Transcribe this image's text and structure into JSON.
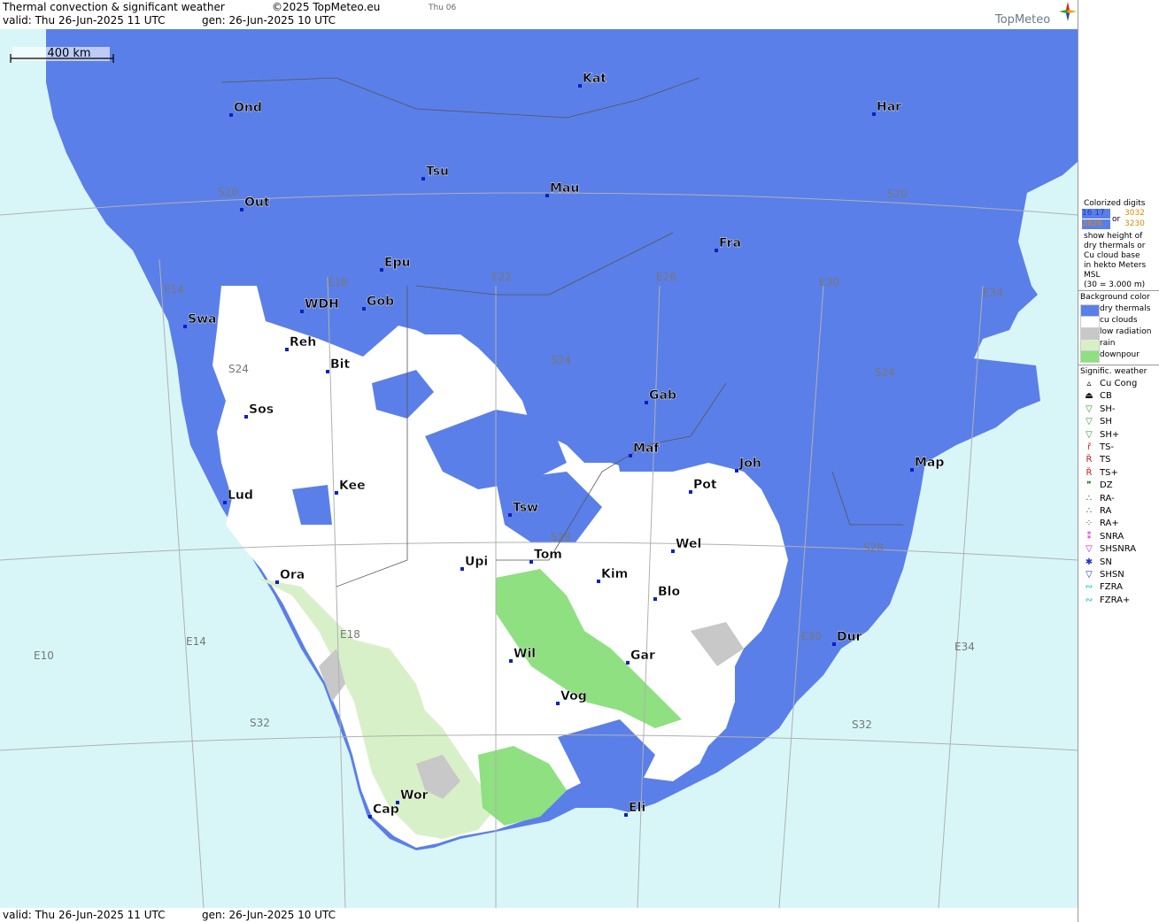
{
  "header": {
    "title": "Thermal convection & significant weather",
    "copyright": "©2025 TopMeteo.eu",
    "day_small": "Thu 06",
    "valid": "valid:  Thu   26-Jun-2025  11 UTC",
    "generated": "gen:  26-Jun-2025 10 UTC",
    "logo": "TopMeteo"
  },
  "footer": {
    "valid": "valid:  Thu   26-Jun-2025  11 UTC",
    "generated": "gen:  26-Jun-2025 10 UTC"
  },
  "scale_bar": "400 km",
  "colors": {
    "sea": "#d8f6f8",
    "dry_thermals": "#5b7fe8",
    "cu_clouds": "#ffffff",
    "low_radiation": "#c8c8c8",
    "rain": "#d8f0c8",
    "downpour": "#8ee080",
    "digit_low": "#1a3cc8",
    "digit_mid": "#2e9a2e",
    "digit_high": "#d98c00",
    "digit_vhigh": "#c81e1e"
  },
  "grid_labels": {
    "meridians": [
      "E10",
      "E14",
      "E14",
      "E18",
      "E18",
      "E22",
      "E26",
      "E30",
      "E30",
      "E34",
      "E34"
    ],
    "parallels": [
      "S20",
      "S20",
      "S24",
      "S24",
      "S24",
      "S28",
      "S28",
      "S32",
      "S32"
    ]
  },
  "cities": [
    {
      "name": "Kat"
    },
    {
      "name": "Har"
    },
    {
      "name": "Ond"
    },
    {
      "name": "Tsu"
    },
    {
      "name": "Mau"
    },
    {
      "name": "Out"
    },
    {
      "name": "Fra"
    },
    {
      "name": "Epu"
    },
    {
      "name": "WDH"
    },
    {
      "name": "Gob"
    },
    {
      "name": "Swa"
    },
    {
      "name": "Reh"
    },
    {
      "name": "Bit"
    },
    {
      "name": "Gab"
    },
    {
      "name": "Sos"
    },
    {
      "name": "Maf"
    },
    {
      "name": "Joh"
    },
    {
      "name": "Map"
    },
    {
      "name": "Lud"
    },
    {
      "name": "Kee"
    },
    {
      "name": "Pot"
    },
    {
      "name": "Tsw"
    },
    {
      "name": "Wel"
    },
    {
      "name": "Upi"
    },
    {
      "name": "Tom"
    },
    {
      "name": "Kim"
    },
    {
      "name": "Ora"
    },
    {
      "name": "Blo"
    },
    {
      "name": "Dur"
    },
    {
      "name": "Wil"
    },
    {
      "name": "Gar"
    },
    {
      "name": "Vog"
    },
    {
      "name": "Wor"
    },
    {
      "name": "Cap"
    },
    {
      "name": "Eli"
    }
  ],
  "legend": {
    "colorized_title": "Colorized digits",
    "digit_samples": [
      "16 17",
      "3032",
      "2826",
      "3230"
    ],
    "or": "or",
    "colorized_desc": [
      "show height of",
      "dry thermals or",
      "Cu cloud base",
      "in hekto Meters",
      "MSL",
      "(30 = 3.000 m)"
    ],
    "background_title": "Background color",
    "background_items": [
      {
        "label": "dry thermals",
        "color": "#5b7fe8"
      },
      {
        "label": "cu clouds",
        "color": "#ffffff"
      },
      {
        "label": "low radiation",
        "color": "#c8c8c8"
      },
      {
        "label": "rain",
        "color": "#d8f0c8"
      },
      {
        "label": "downpour",
        "color": "#8ee080"
      }
    ],
    "weather_title": "Signific. weather",
    "weather_items": [
      {
        "label": "Cu Cong",
        "icon": "cu-cong-icon",
        "glyph": "▵",
        "color": "#000"
      },
      {
        "label": "CB",
        "icon": "cb-icon",
        "glyph": "⏏",
        "color": "#000"
      },
      {
        "label": "SH-",
        "icon": "shower-light-icon",
        "glyph": "▽",
        "color": "#2e9a2e"
      },
      {
        "label": "SH",
        "icon": "shower-icon",
        "glyph": "▽",
        "color": "#2e9a2e"
      },
      {
        "label": "SH+",
        "icon": "shower-heavy-icon",
        "glyph": "▽",
        "color": "#2e9a2e"
      },
      {
        "label": "TS-",
        "icon": "thunderstorm-light-icon",
        "glyph": "ř",
        "color": "#c81e1e"
      },
      {
        "label": "TS",
        "icon": "thunderstorm-icon",
        "glyph": "Ř",
        "color": "#c81e1e"
      },
      {
        "label": "TS+",
        "icon": "thunderstorm-heavy-icon",
        "glyph": "Ř",
        "color": "#c81e1e"
      },
      {
        "label": "DZ",
        "icon": "drizzle-icon",
        "glyph": "❞",
        "color": "#1a6a1a"
      },
      {
        "label": "RA-",
        "icon": "rain-light-icon",
        "glyph": "∴",
        "color": "#1a6a1a"
      },
      {
        "label": "RA",
        "icon": "rain-icon",
        "glyph": "∴",
        "color": "#1a6a1a"
      },
      {
        "label": "RA+",
        "icon": "rain-heavy-icon",
        "glyph": "⁘",
        "color": "#1a6a1a"
      },
      {
        "label": "SNRA",
        "icon": "snow-rain-icon",
        "glyph": "⁑",
        "color": "#c020c0"
      },
      {
        "label": "SHSNRA",
        "icon": "shower-snow-rain-icon",
        "glyph": "▽",
        "color": "#c020c0"
      },
      {
        "label": "SN",
        "icon": "snow-icon",
        "glyph": "✱",
        "color": "#2030d0"
      },
      {
        "label": "SHSN",
        "icon": "shower-snow-icon",
        "glyph": "▽",
        "color": "#2030d0"
      },
      {
        "label": "FZRA",
        "icon": "freezing-rain-icon",
        "glyph": "∾",
        "color": "#10b8d8"
      },
      {
        "label": "FZRA+",
        "icon": "freezing-rain-heavy-icon",
        "glyph": "∾",
        "color": "#10b8d8"
      }
    ]
  }
}
